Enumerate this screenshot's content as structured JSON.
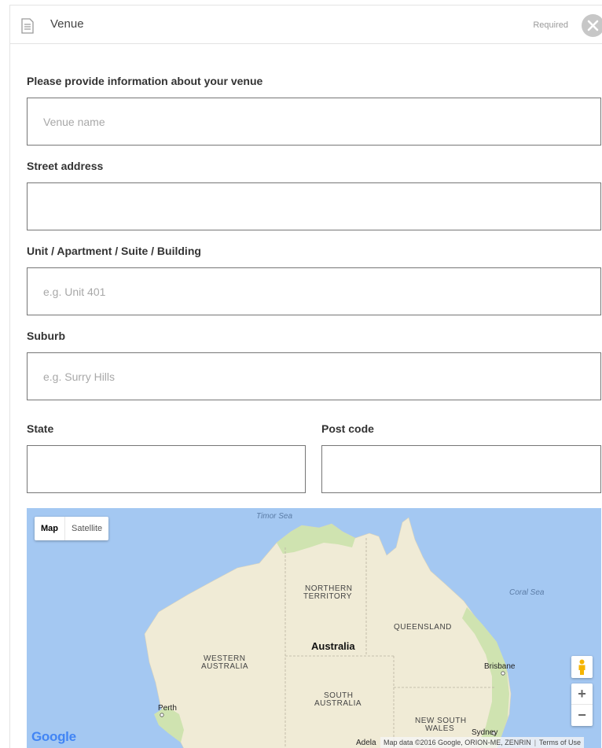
{
  "header": {
    "title": "Venue",
    "required_text": "Required",
    "icon": "document-icon",
    "close_icon": "close-icon"
  },
  "form": {
    "venue_label": "Please provide information about your venue",
    "venue_placeholder": "Venue name",
    "venue_value": "",
    "street_label": "Street address",
    "street_value": "",
    "unit_label": "Unit / Apartment / Suite / Building",
    "unit_placeholder": "e.g. Unit 401",
    "suburb_label": "Suburb",
    "suburb_placeholder": "e.g. Surry Hills",
    "state_label": "State",
    "postcode_label": "Post code"
  },
  "map": {
    "type_map": "Map",
    "type_satellite": "Satellite",
    "zoom_in": "+",
    "zoom_out": "−",
    "pegman_icon": "pegman-icon",
    "logo": "Google",
    "attribution": "Map data ©2016 Google, ORION-ME, ZENRIN",
    "terms": "Terms of Use",
    "labels": {
      "timor_sea": "Timor Sea",
      "coral_sea": "Coral Sea",
      "northern_territory_1": "NORTHERN",
      "northern_territory_2": "TERRITORY",
      "queensland": "QUEENSLAND",
      "australia": "Australia",
      "western_australia_1": "WESTERN",
      "western_australia_2": "AUSTRALIA",
      "south_australia_1": "SOUTH",
      "south_australia_2": "AUSTRALIA",
      "nsw_1": "NEW SOUTH",
      "nsw_2": "WALES",
      "brisbane": "Brisbane",
      "perth": "Perth",
      "sydney": "Sydney",
      "adelaide": "Adela"
    },
    "colors": {
      "water": "#a4c8f2",
      "land": "#f0ebd6",
      "vegetation": "#cfe3b0"
    }
  }
}
